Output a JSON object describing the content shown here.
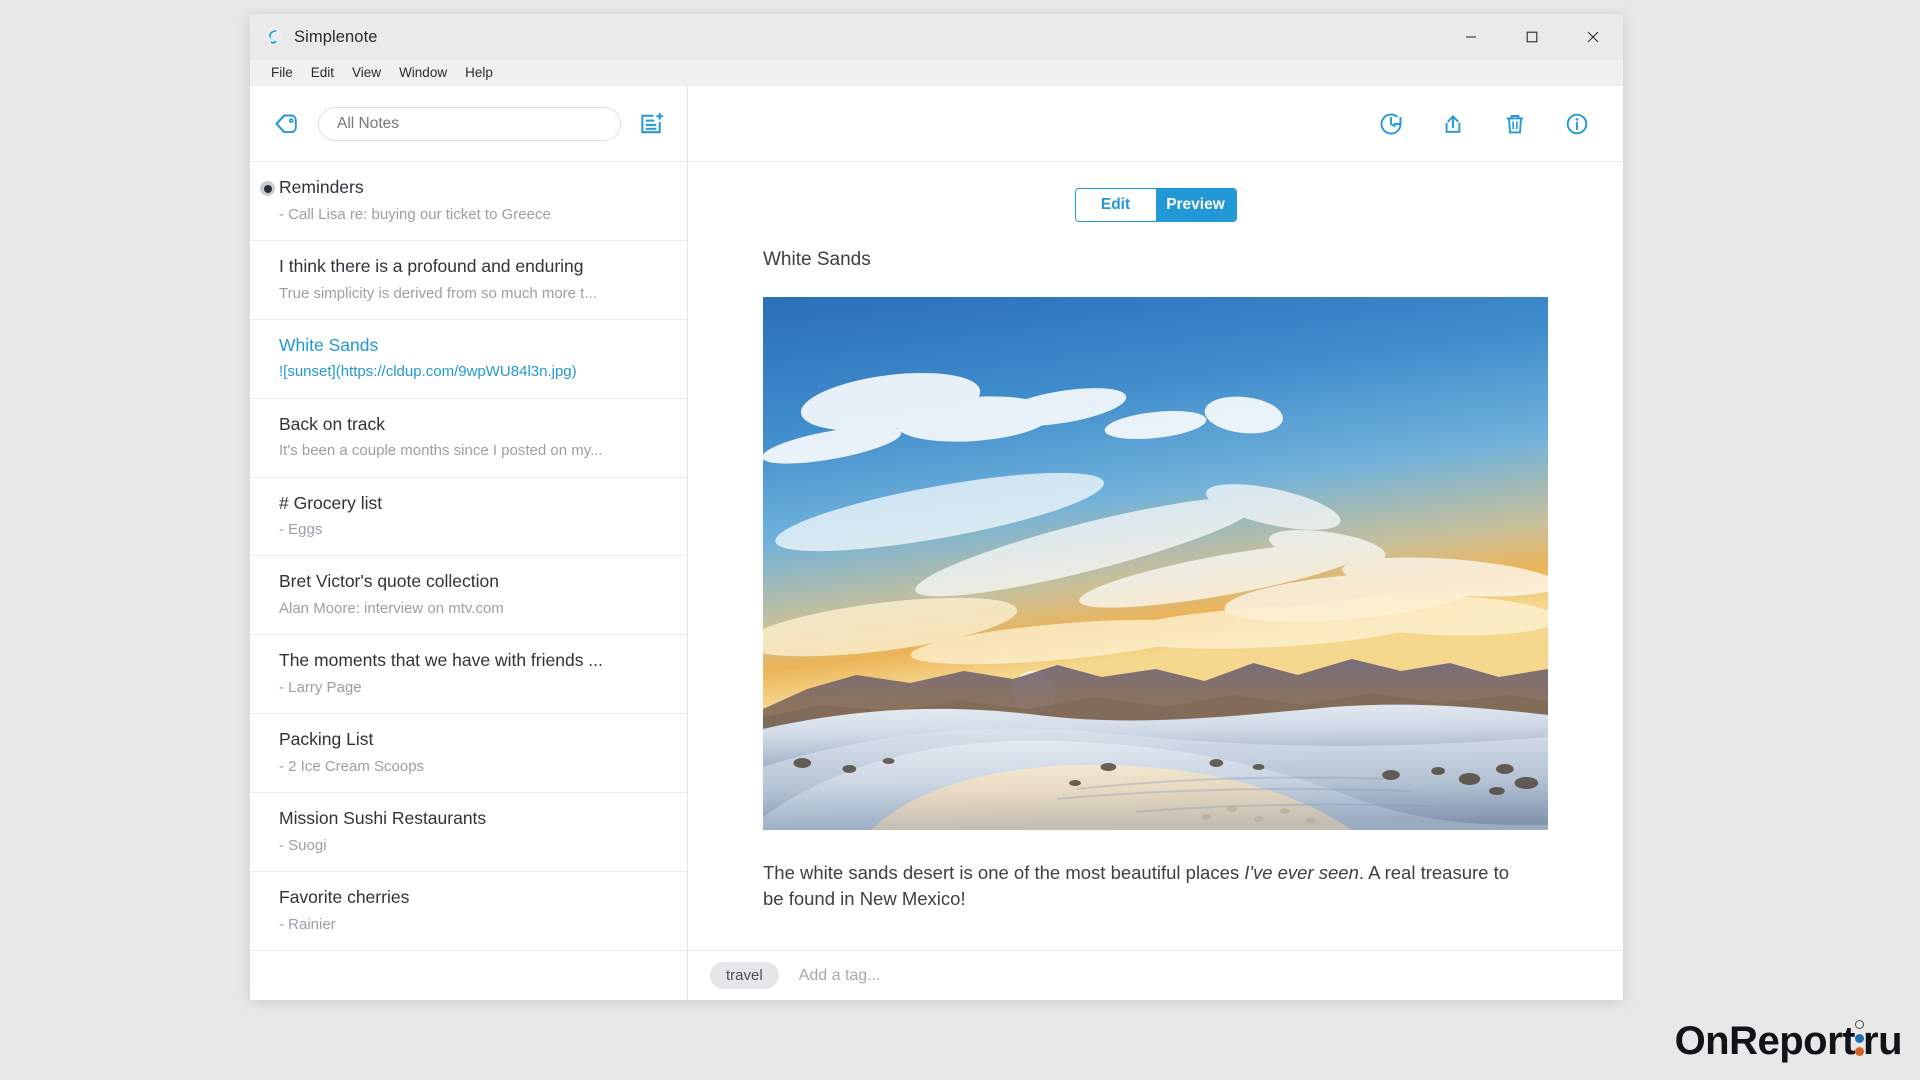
{
  "window": {
    "app_title": "Simplenote",
    "app_icon": "simplenote-logo-icon",
    "controls": {
      "minimize_label": "Minimize",
      "maximize_label": "Maximize",
      "close_label": "Close"
    }
  },
  "menu": {
    "items": [
      {
        "label": "File"
      },
      {
        "label": "Edit"
      },
      {
        "label": "View"
      },
      {
        "label": "Window"
      },
      {
        "label": "Help"
      }
    ]
  },
  "search": {
    "value": "",
    "placeholder": "All Notes",
    "tag_drawer_icon": "tag-back-icon",
    "new_note_icon": "new-note-icon"
  },
  "note_list": {
    "items": [
      {
        "title": "Reminders",
        "excerpt": "- Call Lisa re: buying our ticket to Greece",
        "selected": false,
        "published": true
      },
      {
        "title": "I think there is a profound and enduring",
        "excerpt": "True simplicity is derived from so much more t...",
        "selected": false,
        "published": false
      },
      {
        "title": "White Sands",
        "excerpt": "![sunset](https://cldup.com/9wpWU84l3n.jpg)",
        "selected": true,
        "published": false
      },
      {
        "title": "Back on track",
        "excerpt": "It's been a couple months since I posted on my...",
        "selected": false,
        "published": false
      },
      {
        "title": "# Grocery list",
        "excerpt": "- Eggs",
        "selected": false,
        "published": false
      },
      {
        "title": "Bret Victor's quote collection",
        "excerpt": "Alan Moore: interview on mtv.com",
        "selected": false,
        "published": false
      },
      {
        "title": "The moments that we have with friends ...",
        "excerpt": "- Larry Page",
        "selected": false,
        "published": false
      },
      {
        "title": "Packing List",
        "excerpt": "- 2 Ice Cream Scoops",
        "selected": false,
        "published": false
      },
      {
        "title": "Mission Sushi Restaurants",
        "excerpt": "- Suogi",
        "selected": false,
        "published": false
      },
      {
        "title": "Favorite cherries",
        "excerpt": "- Rainier",
        "selected": false,
        "published": false
      }
    ]
  },
  "note_toolbar": {
    "buttons": [
      {
        "icon": "history-icon",
        "label": "History"
      },
      {
        "icon": "share-icon",
        "label": "Share"
      },
      {
        "icon": "trash-icon",
        "label": "Trash"
      },
      {
        "icon": "info-icon",
        "label": "Info"
      }
    ]
  },
  "editor": {
    "mode_toggle": {
      "edit_label": "Edit",
      "preview_label": "Preview",
      "active": "Preview"
    },
    "heading": "White Sands",
    "image_alt": "sunset",
    "body_before_em": "The white sands desert is one of the most beautiful places ",
    "body_em": "I've ever seen",
    "body_after_em": ". A real treasure to be found in New Mexico!"
  },
  "tag_bar": {
    "tags": [
      "travel"
    ],
    "add_tag_placeholder": "Add a tag..."
  },
  "watermark": {
    "name_left": "OnReport",
    "name_right": "ru"
  },
  "colors": {
    "accent_blue": "#2299d6",
    "title_bar": "#eaeaea",
    "menu_bar": "#f0f0f0",
    "desktop": "#e8e8e8",
    "excerpt_gray": "#9aa0a6",
    "text_dark": "#2f3337",
    "tag_chip": "#e4e6e8",
    "watermark_blue": "#1c6fb5",
    "watermark_orange": "#d9622b"
  }
}
